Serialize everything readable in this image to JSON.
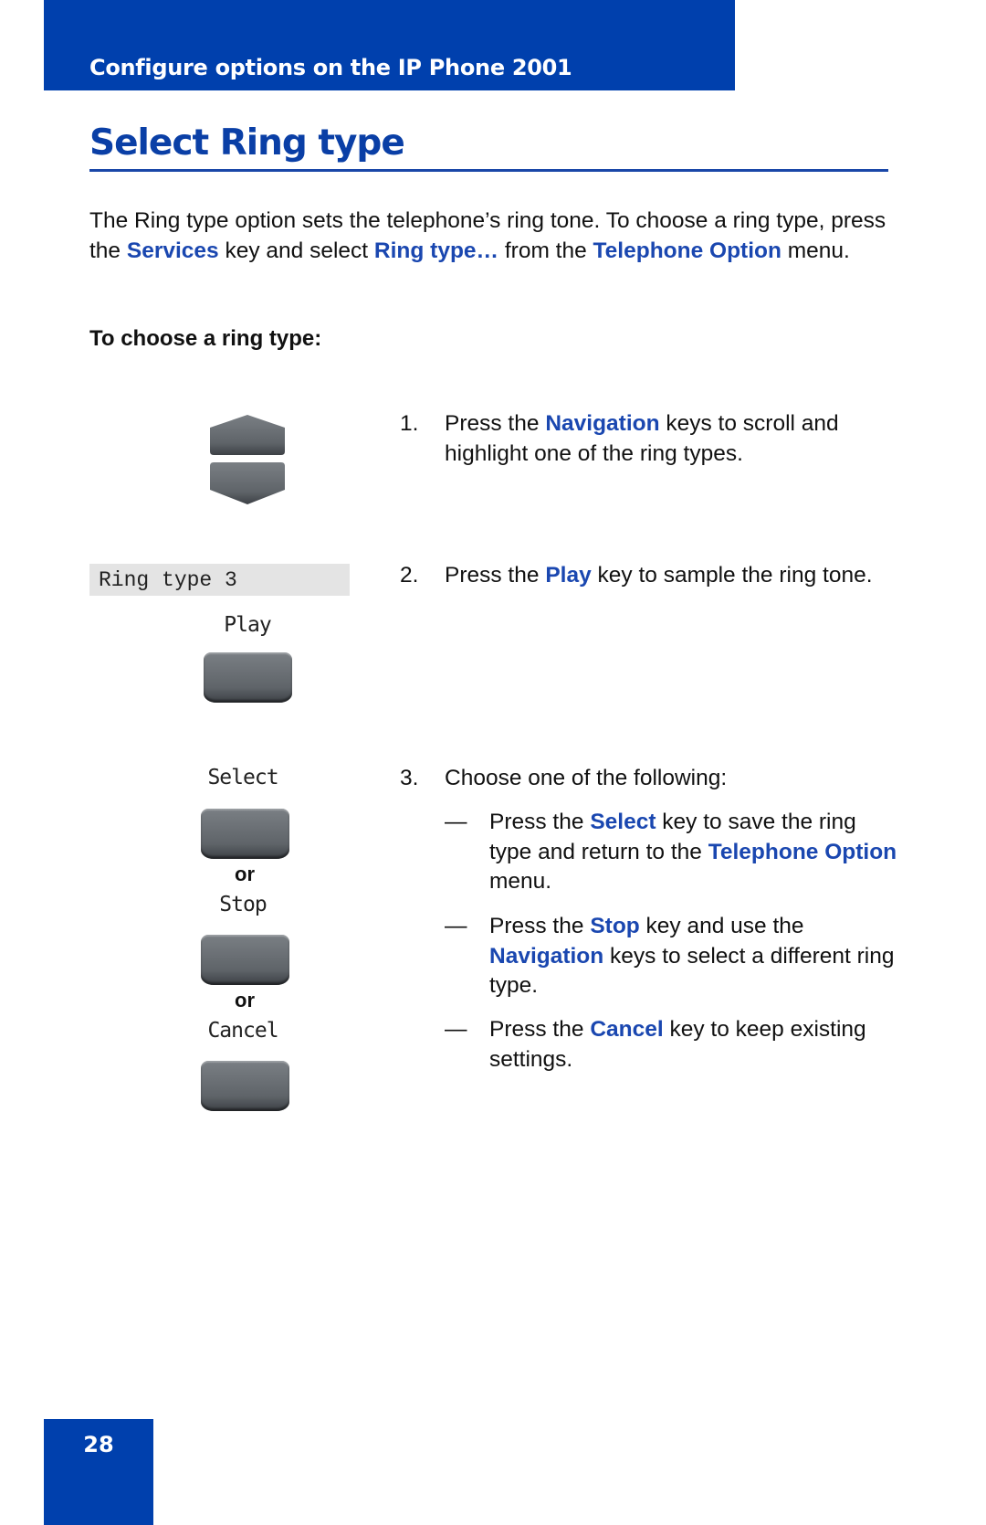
{
  "header": {
    "section_title": "Configure options on the IP Phone 2001"
  },
  "page": {
    "title": "Select Ring type",
    "intro": {
      "t1": "The Ring type option sets the telephone’s ring tone. To choose a ring type, press the ",
      "k1": "Services",
      "t2": " key and select ",
      "k2": "Ring type…",
      "t3": " from the ",
      "k3": "Telephone Option",
      "t4": " menu."
    },
    "procedure_heading": "To choose a ring type:",
    "steps": [
      {
        "number": "1.",
        "t1": "Press the ",
        "k1": "Navigation",
        "t2": " keys to scroll and highlight one of the ring types."
      },
      {
        "number": "2.",
        "t1": "Press the ",
        "k1": "Play",
        "t2": " key to sample the ring tone."
      },
      {
        "number": "3.",
        "t1": "Choose one of the following:"
      }
    ],
    "options": [
      {
        "dash": "—",
        "t1": "Press the ",
        "k1": "Select",
        "t2": " key to save the ring type and return to the ",
        "k2": "Telephone Option",
        "t3": " menu."
      },
      {
        "dash": "—",
        "t1": "Press the ",
        "k1": "Stop",
        "t2": " key and use the ",
        "k2": "Navigation",
        "t3": " keys to select a different ring type."
      },
      {
        "dash": "—",
        "t1": "Press the ",
        "k1": "Cancel",
        "t2": " key to keep existing settings."
      }
    ]
  },
  "illustrations": {
    "lcd_display": "Ring type 3",
    "softkeys": {
      "play": "Play",
      "select": "Select",
      "stop": "Stop",
      "cancel": "Cancel"
    },
    "or_label": "or"
  },
  "footer": {
    "page_number": "28"
  },
  "colors": {
    "brand_blue": "#0040ad",
    "keyword_blue": "#1a47b0",
    "key_gray": "#63686d"
  }
}
